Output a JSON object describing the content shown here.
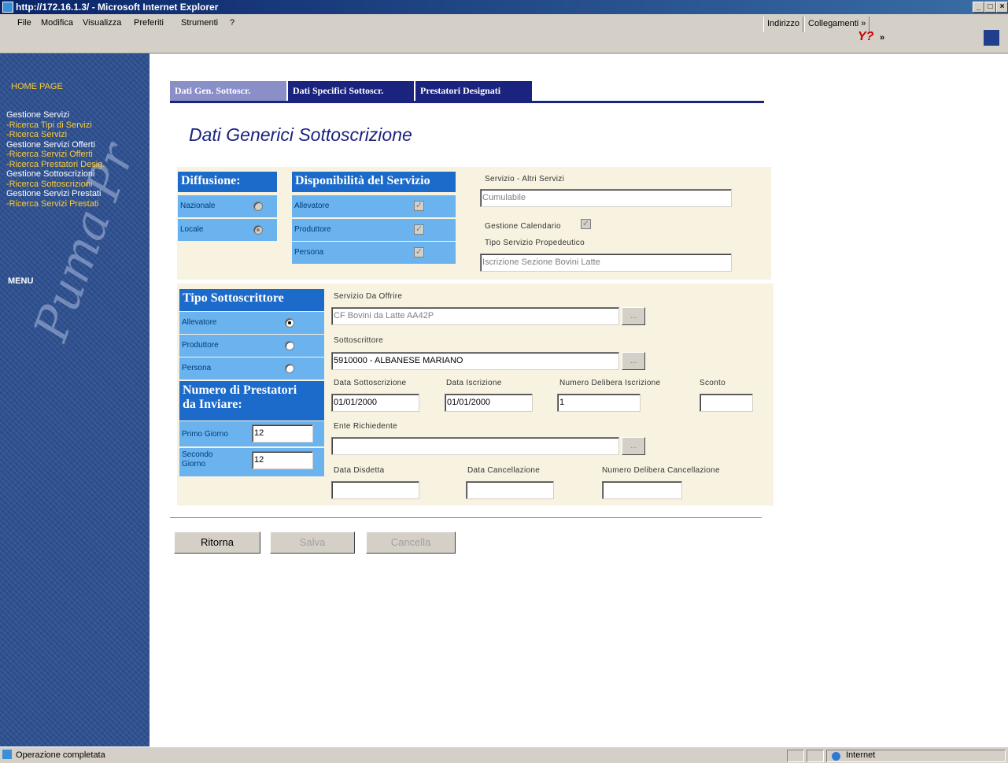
{
  "window": {
    "title": "http://172.16.1.3/ - Microsoft Internet Explorer"
  },
  "menu": {
    "items": [
      "File",
      "Modifica",
      "Visualizza",
      "Preferiti",
      "Strumenti",
      "?"
    ],
    "address_label": "Indirizzo",
    "links_label": "Collegamenti »",
    "more": "»"
  },
  "sidebar": {
    "home": "HOME PAGE",
    "groups": [
      {
        "head": "Gestione Servizi",
        "links": [
          "-Ricerca Tipi di Servizi",
          "-Ricerca Servizi"
        ]
      },
      {
        "head": "Gestione Servizi Offerti",
        "links": [
          "-Ricerca Servizi Offerti",
          "-Ricerca Prestatori Desig."
        ]
      },
      {
        "head": "Gestione Sottoscrizioni",
        "links": [
          "-Ricerca Sottoscrizioni"
        ]
      },
      {
        "head": "Gestione Servizi Prestati",
        "links": [
          "-Ricerca Servizi Prestati"
        ]
      }
    ],
    "menu": "MENU",
    "script_text": "Puma Pr"
  },
  "tabs": [
    "Dati Gen. Sottoscr.",
    "Dati Specifici Sottoscr.",
    "Prestatori Designati"
  ],
  "title": "Dati Generici Sottoscrizione",
  "diffusione": {
    "head": "Diffusione:",
    "rows": [
      {
        "label": "Nazionale",
        "checked": false
      },
      {
        "label": "Locale",
        "checked": true
      }
    ]
  },
  "disponibilita": {
    "head": "Disponibilità del Servizio",
    "rows": [
      {
        "label": "Allevatore"
      },
      {
        "label": "Produttore"
      },
      {
        "label": "Persona"
      }
    ]
  },
  "servizio_altri": {
    "label": "Servizio - Altri Servizi",
    "value": "Cumulabile"
  },
  "gestione_calendario": "Gestione Calendario",
  "tipo_propedeutico": {
    "label": "Tipo Servizio Propedeutico",
    "value": "Iscrizione Sezione Bovini Latte"
  },
  "tipo_sottoscrittore": {
    "head": "Tipo Sottoscrittore",
    "rows": [
      {
        "label": "Allevatore",
        "checked": true
      },
      {
        "label": "Produttore",
        "checked": false
      },
      {
        "label": "Persona",
        "checked": false
      }
    ]
  },
  "numero_prestatori": {
    "head1": "Numero di Prestatori",
    "head2": "da Inviare:",
    "primo_label": "Primo Giorno",
    "primo_value": "12",
    "secondo_label1": "Secondo",
    "secondo_label2": "Giorno",
    "secondo_value": "12"
  },
  "servizio_da_offrire": {
    "label": "Servizio Da Offrire",
    "value": "CF Bovini da Latte AA42P"
  },
  "sottoscrittore": {
    "label": "Sottoscrittore",
    "value": "5910000 - ALBANESE MARIANO"
  },
  "data_sottoscrizione": {
    "label": "Data Sottoscrizione",
    "value": "01/01/2000"
  },
  "data_iscrizione": {
    "label": "Data Iscrizione",
    "value": "01/01/2000"
  },
  "numero_delibera_iscrizione": {
    "label": "Numero Delibera Iscrizione",
    "value": "1"
  },
  "sconto": {
    "label": "Sconto",
    "value": ""
  },
  "ente_richiedente": {
    "label": "Ente Richiedente",
    "value": ""
  },
  "data_disdetta": {
    "label": "Data Disdetta",
    "value": ""
  },
  "data_cancellazione": {
    "label": "Data Cancellazione",
    "value": ""
  },
  "numero_delibera_cancellazione": {
    "label": "Numero Delibera Cancellazione",
    "value": ""
  },
  "dots": "...",
  "buttons": {
    "ritorna": "Ritorna",
    "salva": "Salva",
    "cancella": "Cancella"
  },
  "status": {
    "text": "Operazione completata",
    "zone": "Internet"
  },
  "colors": {
    "tab_active": "#8b8fc8",
    "tab_inactive": "#1a237e",
    "panel": "#f8f2e0",
    "blue_head": "#1c6ac9",
    "blue_cell": "#6ab3ee",
    "sidebar": "#2e5090"
  }
}
